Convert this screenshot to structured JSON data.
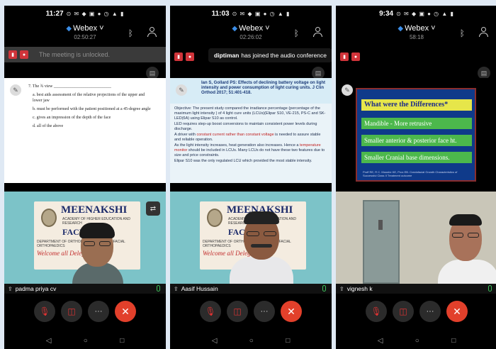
{
  "phones": [
    {
      "status_time": "11:27",
      "app": "Webex",
      "timer": "02:50:27",
      "banner": "The meeting is unlocked.",
      "slide": {
        "q": "7. The ¾ view ___________________________",
        "a": "a.  best aids assessment of the relative projections of the upper and lower jaw",
        "b": "b.  must be performed with the patient positioned at a 45-degree angle",
        "c": "c.  gives an impression of the depth of the face",
        "d": "d.  all of the above"
      },
      "participant": "padma priya cv"
    },
    {
      "status_time": "11:03",
      "app": "Webex",
      "timer": "02:26:02",
      "toast_name": "diptiman",
      "toast_msg": "has joined the audio conference",
      "slide": {
        "header": "Ian S, Gollard PS: Effects of declining battery voltage on light intensity and power consumption of light curing units. J Clin Orthod 2017; 51:401-418.",
        "b1": "Objective: The present study compared the irradiance percentage (percentage of the maximum light intensity ) of 4 light cure units (LCUs)(Elipar S10, VE-215, PS-C and SK-LED(6A) using Elipar S10 as control.",
        "b2": "LED requires step-up boost conversions to maintain consistent power levels during discharge.",
        "b3a": "A driver with ",
        "b3b": "constant current rather than constant voltage",
        "b3c": " is needed to assure stable and reliable operation.",
        "b4a": "As the light intensity increases, heat generation also increases. Hence a ",
        "b4b": "temperature monitor",
        "b4c": " should be included in LCUs. Many LCUs do not have these two features due to size and price constraints.",
        "b5": "Elipar S10 was the only regulated LCU which provided the most stable intensity."
      },
      "participant": "Aasif Hussain"
    },
    {
      "status_time": "9:34",
      "app": "Webex",
      "timer": "58:18",
      "slide": {
        "title": "What were the Differences*",
        "r1": "Mandible - More retrusive",
        "r2": "Smaller anterior & posterior face ht.",
        "r3": "Smaller Cranial base dimensions.",
        "ref": "Proff RE, R C. Moushe KE, Prox EB. Craniofacial Growth Characteristics of Successful Class II Treatment outcome"
      },
      "participant": "vignesh k"
    }
  ],
  "banner_img": {
    "title": "MEENAKSHI",
    "sub": "ACADEMY OF HIGHER EDUCATION AND RESEARCH",
    "faculty": "FACULTY",
    "dept": "DEPARTMENT OF ORTHODONTICS & DENTOFACIAL ORTHOPAEDICS",
    "welcome": "Welcome all Delegates"
  },
  "colors": {
    "end_call": "#e2402b",
    "accent": "#3c8ee8",
    "mic_on": "#3cc25a"
  }
}
